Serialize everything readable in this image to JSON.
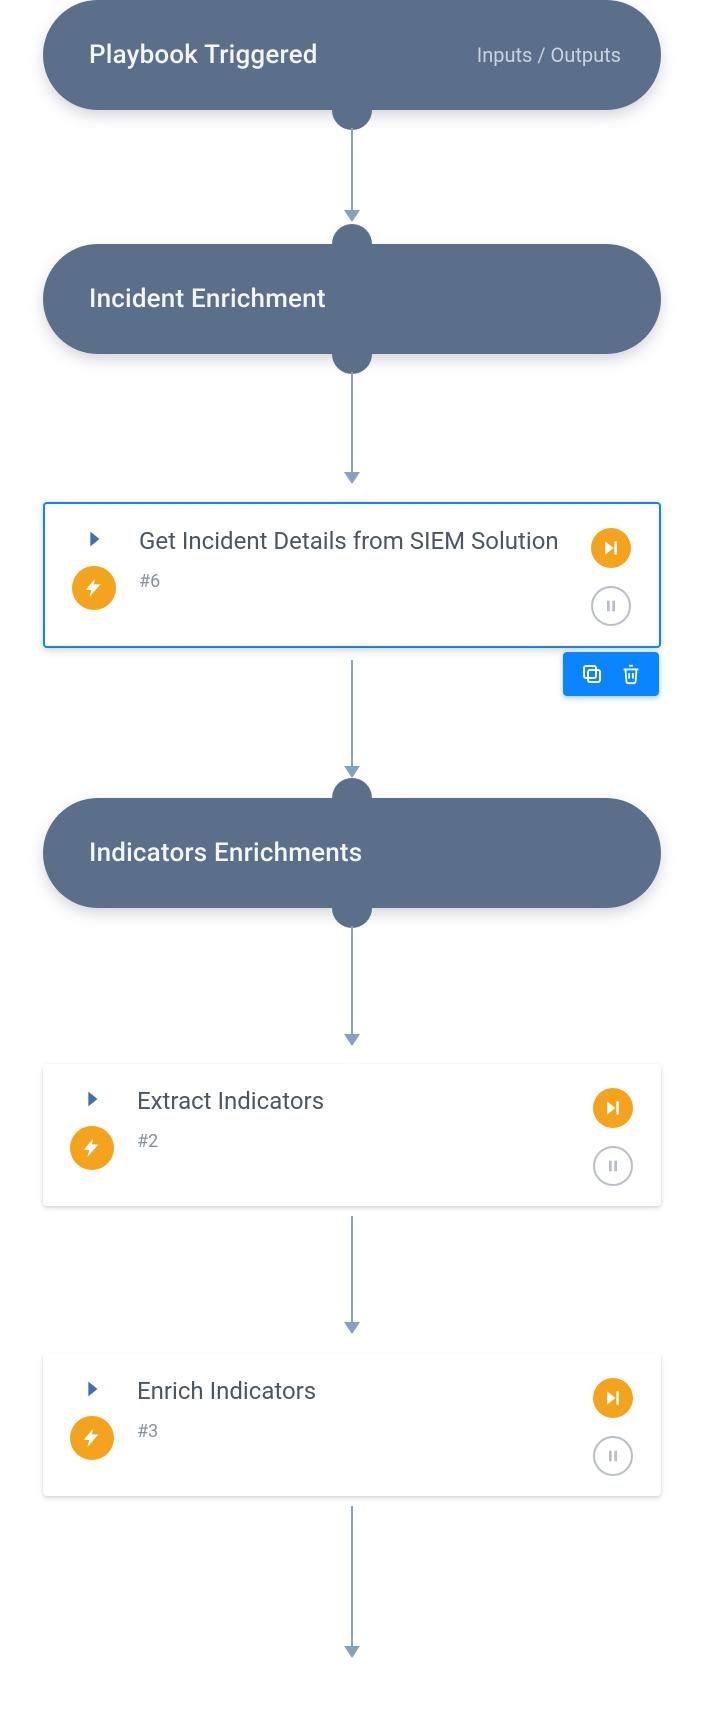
{
  "colors": {
    "slate": "#5b6f8a",
    "orange": "#f4a31d",
    "blue": "#0a84ff",
    "softBlue": "#86a0bd"
  },
  "nodes": {
    "start": {
      "title": "Playbook Triggered",
      "meta": "Inputs / Outputs"
    },
    "section1": {
      "title": "Incident Enrichment"
    },
    "task1": {
      "title": "Get Incident Details from SIEM Solution",
      "id": "#6",
      "selected": true
    },
    "section2": {
      "title": "Indicators Enrichments"
    },
    "task2": {
      "title": "Extract Indicators",
      "id": "#2",
      "selected": false
    },
    "task3": {
      "title": "Enrich Indicators",
      "id": "#3",
      "selected": false
    }
  }
}
